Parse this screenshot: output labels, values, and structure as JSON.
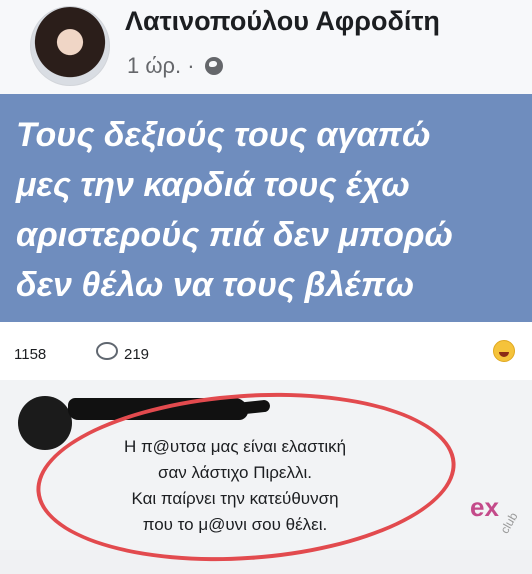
{
  "post": {
    "author": "Λατινοπούλου Αφροδίτη",
    "time": "1 ώρ.",
    "separator": "·",
    "privacy_icon": "globe-icon",
    "background_color": "#6f8dbe",
    "lines": [
      "Τους δεξιούς τους αγαπώ",
      "μες την καρδιά τους έχω",
      "αριστερούς πιά δεν μπορώ",
      "δεν θέλω να τους βλέπω"
    ]
  },
  "engagement": {
    "reactions_count": "1158",
    "comment_icon": "comment-bubble-icon",
    "comments_count": "219",
    "emoji_icon": "laughing-emoji-icon"
  },
  "comment": {
    "lines": [
      "Η π@υτσα μας είναι ελαστική",
      "σαν λάστιχο Πιρελλι.",
      "Και παίρνει την κατεύθυνση",
      "που το μ@υνι σου θέλει."
    ],
    "annotation_color": "#e24a4e"
  },
  "watermark": {
    "big": "ex",
    "small": "club"
  }
}
